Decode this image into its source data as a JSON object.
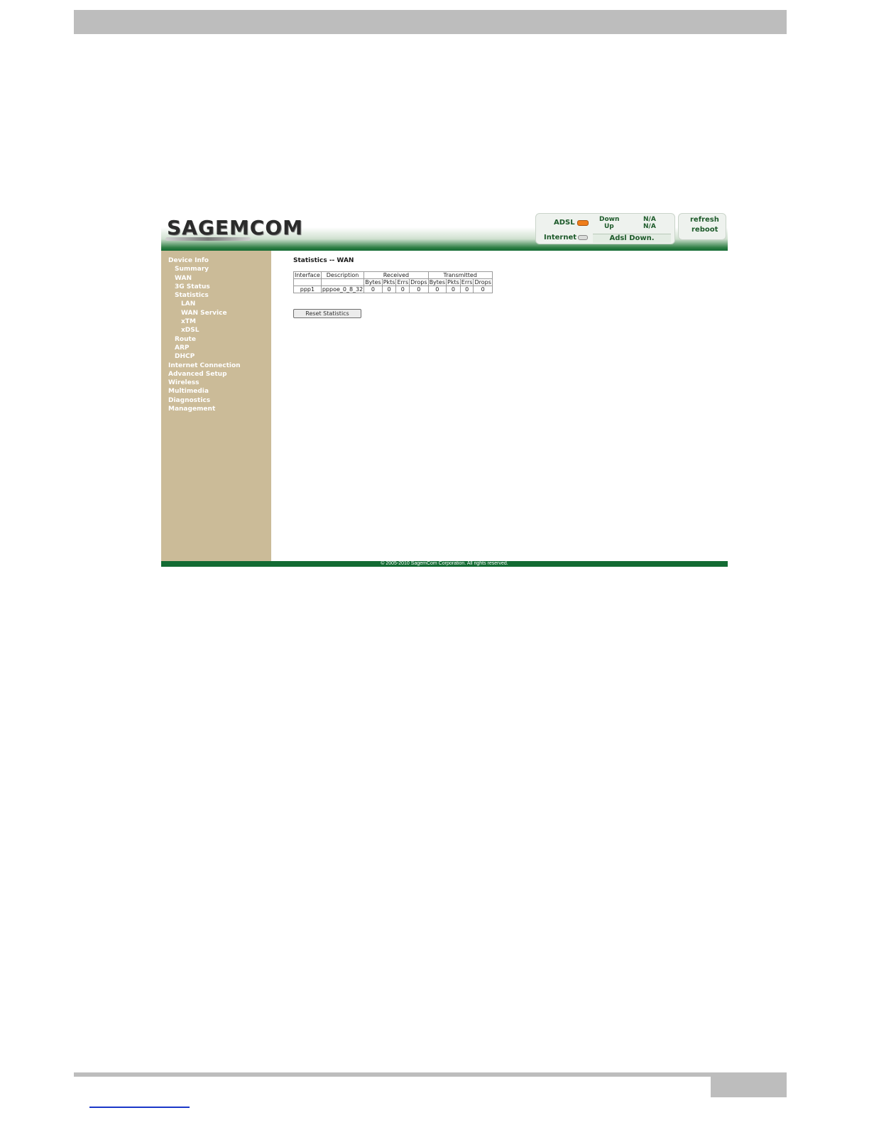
{
  "brand": {
    "logo_text": "SAGEMCOM"
  },
  "status": {
    "adsl_label": "ADSL",
    "internet_label": "Internet",
    "down_label": "Down",
    "up_label": "Up",
    "down_value": "N/A",
    "up_value": "N/A",
    "adsl_state": "Adsl Down.",
    "adsl_led_color": "#ef7d1a",
    "internet_led_color": "#d9dbd9"
  },
  "actions": {
    "refresh": "refresh",
    "reboot": "reboot"
  },
  "sidebar": {
    "items": [
      {
        "label": "Device Info",
        "level": 0
      },
      {
        "label": "Summary",
        "level": 1
      },
      {
        "label": "WAN",
        "level": 1
      },
      {
        "label": "3G Status",
        "level": 1
      },
      {
        "label": "Statistics",
        "level": 1
      },
      {
        "label": "LAN",
        "level": 2
      },
      {
        "label": "WAN Service",
        "level": 2
      },
      {
        "label": "xTM",
        "level": 2
      },
      {
        "label": "xDSL",
        "level": 2
      },
      {
        "label": "Route",
        "level": 1
      },
      {
        "label": "ARP",
        "level": 1
      },
      {
        "label": "DHCP",
        "level": 1
      },
      {
        "label": "Internet Connection",
        "level": 0
      },
      {
        "label": "Advanced Setup",
        "level": 0
      },
      {
        "label": "Wireless",
        "level": 0
      },
      {
        "label": "Multimedia",
        "level": 0
      },
      {
        "label": "Diagnostics",
        "level": 0
      },
      {
        "label": "Management",
        "level": 0
      }
    ]
  },
  "main": {
    "title": "Statistics -- WAN",
    "table": {
      "interface_header": "Interface",
      "description_header": "Description",
      "received_header": "Received",
      "transmitted_header": "Transmitted",
      "sub_headers": [
        "Bytes",
        "Pkts",
        "Errs",
        "Drops",
        "Bytes",
        "Pkts",
        "Errs",
        "Drops"
      ],
      "rows": [
        [
          "ppp1",
          "pppoe_0_8_32",
          "0",
          "0",
          "0",
          "0",
          "0",
          "0",
          "0",
          "0"
        ]
      ]
    },
    "reset_button": "Reset Statistics"
  },
  "footer": {
    "copyright": "© 2005-2010 SagemCom Corporation. All rights reserved."
  },
  "colors": {
    "banner_green": "#136b33",
    "sidebar_tan": "#cbbb98"
  }
}
